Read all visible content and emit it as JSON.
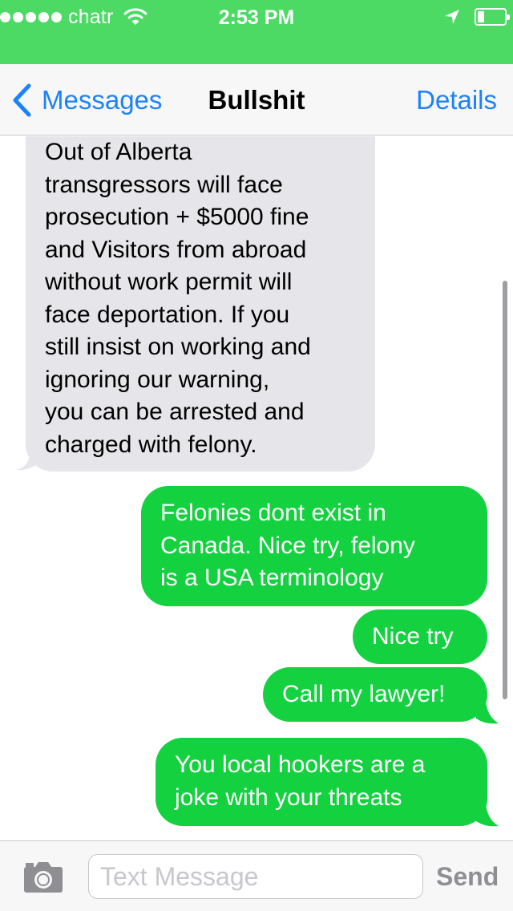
{
  "status_bar": {
    "carrier": "chatr",
    "time": "2:53 PM"
  },
  "nav": {
    "back_label": "Messages",
    "title": "Bullshit",
    "details_label": "Details"
  },
  "messages": [
    {
      "direction": "received",
      "lines": [
        "Out of Alberta",
        "transgressors will face",
        "prosecution + $5000 fine",
        "and Visitors from abroad",
        "without work permit will",
        "face deportation. If you",
        "still insist on working and",
        "ignoring our warning,",
        "you can be arrested and",
        "charged with felony."
      ]
    },
    {
      "direction": "sent",
      "lines": [
        "Felonies dont exist in",
        "Canada.  Nice try, felony",
        "is a USA terminology"
      ]
    },
    {
      "direction": "sent",
      "lines": [
        "Nice try"
      ]
    },
    {
      "direction": "sent",
      "lines": [
        "Call my lawyer!"
      ]
    },
    {
      "direction": "sent",
      "lines": [
        "You local hookers are a",
        "joke with your threats"
      ]
    }
  ],
  "input": {
    "placeholder": "Text Message",
    "send_label": "Send"
  },
  "colors": {
    "status_bar": "#4cd964",
    "sent_bubble": "#14d140",
    "received_bubble": "#e5e5ea",
    "accent": "#1b82fb"
  }
}
